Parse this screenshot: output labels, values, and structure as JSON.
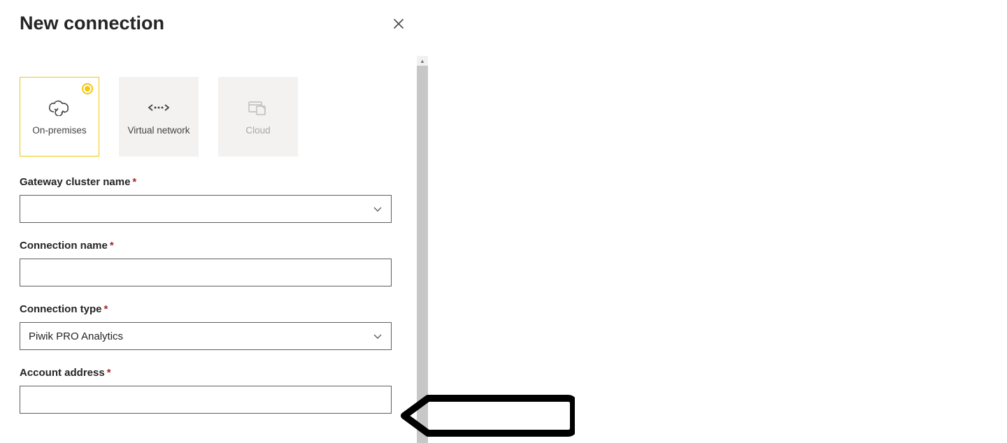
{
  "header": {
    "title": "New connection"
  },
  "tiles": [
    {
      "label": "On-premises",
      "selected": true,
      "disabled": false,
      "icon": "cloud-sync"
    },
    {
      "label": "Virtual network",
      "selected": false,
      "disabled": false,
      "icon": "vnet"
    },
    {
      "label": "Cloud",
      "selected": false,
      "disabled": true,
      "icon": "cloud-file"
    }
  ],
  "fields": {
    "gateway_cluster": {
      "label": "Gateway cluster name",
      "required": true,
      "value": ""
    },
    "connection_name": {
      "label": "Connection name",
      "required": true,
      "value": ""
    },
    "connection_type": {
      "label": "Connection type",
      "required": true,
      "value": "Piwik PRO Analytics"
    },
    "account_address": {
      "label": "Account address",
      "required": true,
      "value": ""
    }
  },
  "colors": {
    "accent": "#f2c811",
    "required_star": "#a4262c"
  }
}
